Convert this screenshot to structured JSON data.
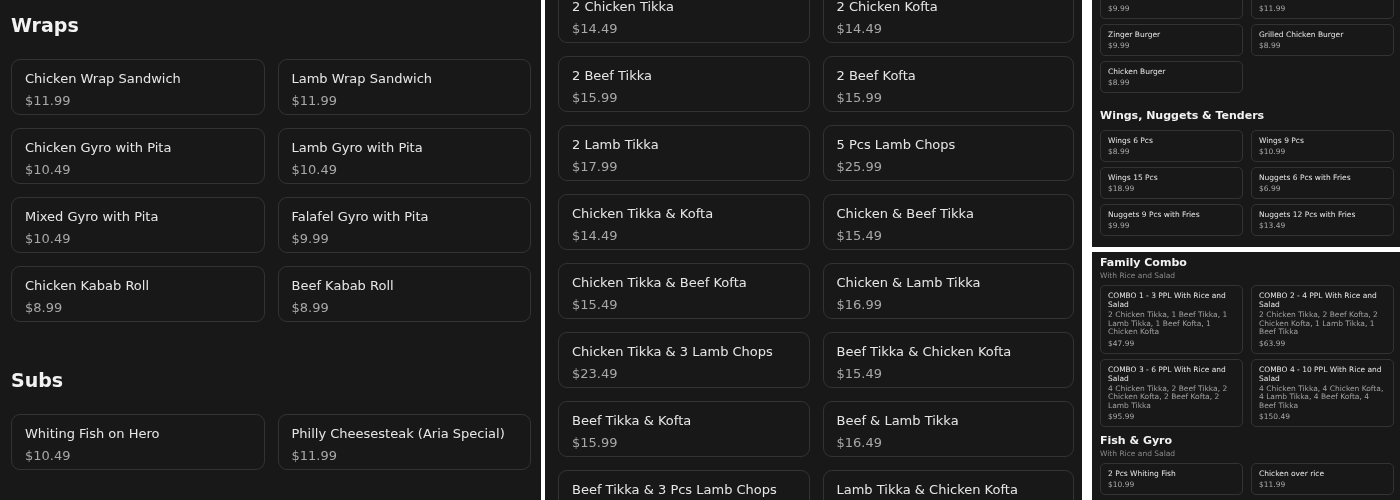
{
  "panels": [
    {
      "sections": [
        {
          "title": "Wraps",
          "items": [
            {
              "name": "Chicken Wrap Sandwich",
              "price": "$11.99"
            },
            {
              "name": "Lamb Wrap Sandwich",
              "price": "$11.99"
            },
            {
              "name": "Chicken Gyro with Pita",
              "price": "$10.49"
            },
            {
              "name": "Lamb Gyro with Pita",
              "price": "$10.49"
            },
            {
              "name": "Mixed Gyro with Pita",
              "price": "$10.49"
            },
            {
              "name": "Falafel Gyro with Pita",
              "price": "$9.99"
            },
            {
              "name": "Chicken Kabab Roll",
              "price": "$8.99"
            },
            {
              "name": "Beef Kabab Roll",
              "price": "$8.99"
            }
          ]
        },
        {
          "title": "Subs",
          "items": [
            {
              "name": "Whiting Fish on Hero",
              "price": "$10.49"
            },
            {
              "name": "Philly Cheesesteak (Aria Special)",
              "price": "$11.99"
            }
          ]
        }
      ]
    },
    {
      "sections": [
        {
          "items": [
            {
              "name": "2 Chicken Tikka",
              "price": "$14.49"
            },
            {
              "name": "2 Chicken Kofta",
              "price": "$14.49"
            },
            {
              "name": "2 Beef Tikka",
              "price": "$15.99"
            },
            {
              "name": "2 Beef Kofta",
              "price": "$15.99"
            },
            {
              "name": "2 Lamb Tikka",
              "price": "$17.99"
            },
            {
              "name": "5 Pcs Lamb Chops",
              "price": "$25.99"
            },
            {
              "name": "Chicken Tikka & Kofta",
              "price": "$14.49"
            },
            {
              "name": "Chicken & Beef Tikka",
              "price": "$15.49"
            },
            {
              "name": "Chicken Tikka & Beef Kofta",
              "price": "$15.49"
            },
            {
              "name": "Chicken & Lamb Tikka",
              "price": "$16.99"
            },
            {
              "name": "Chicken Tikka & 3 Lamb Chops",
              "price": "$23.49"
            },
            {
              "name": "Beef Tikka & Chicken Kofta",
              "price": "$15.49"
            },
            {
              "name": "Beef Tikka & Kofta",
              "price": "$15.99"
            },
            {
              "name": "Beef & Lamb Tikka",
              "price": "$16.49"
            },
            {
              "name": "Beef Tikka & 3 Pcs Lamb Chops"
            },
            {
              "name": "Lamb Tikka & Chicken Kofta"
            }
          ]
        }
      ]
    },
    {
      "sections": [
        {
          "items": [
            {
              "price": "$9.99"
            },
            {
              "price": "$11.99"
            },
            {
              "name": "Zinger Burger",
              "price": "$9.99"
            },
            {
              "name": "Grilled Chicken Burger",
              "price": "$8.99"
            },
            {
              "name": "Chicken Burger",
              "price": "$8.99"
            }
          ]
        },
        {
          "title": "Wings, Nuggets & Tenders",
          "items": [
            {
              "name": "Wings 6 Pcs",
              "price": "$8.99"
            },
            {
              "name": "Wings 9 Pcs",
              "price": "$10.99"
            },
            {
              "name": "Wings 15 Pcs",
              "price": "$18.99"
            },
            {
              "name": "Nuggets 6 Pcs with Fries",
              "price": "$6.99"
            },
            {
              "name": "Nuggets 9 Pcs with Fries",
              "price": "$9.99"
            },
            {
              "name": "Nuggets 12 Pcs with Fries",
              "price": "$13.49"
            }
          ]
        }
      ]
    },
    {
      "sections": [
        {
          "title": "Family Combo",
          "subtitle": "With Rice and Salad",
          "items": [
            {
              "name": "COMBO 1 - 3 PPL With Rice and Salad",
              "description": "2 Chicken Tikka, 1 Beef Tikka, 1 Lamb Tikka, 1 Beef Kofta, 1 Chicken Kofta",
              "price": "$47.99"
            },
            {
              "name": "COMBO 2 - 4 PPL With Rice and Salad",
              "description": "2 Chicken Tikka, 2 Beef Kofta, 2 Chicken Kofta, 1 Lamb Tikka, 1 Beef Tikka",
              "price": "$63.99"
            },
            {
              "name": "COMBO 3 - 6 PPL With Rice and Salad",
              "description": "4 Chicken Tikka, 2 Beef Tikka, 2 Chicken Kofta, 2 Beef Kofta, 2 Lamb Tikka",
              "price": "$95.99"
            },
            {
              "name": "COMBO 4 - 10 PPL With Rice and Salad",
              "description": "4 Chicken Tikka, 4 Chicken Kofta, 4 Lamb Tikka, 4 Beef Kofta, 4 Beef Tikka",
              "price": "$150.49"
            }
          ]
        },
        {
          "title": "Fish & Gyro",
          "subtitle": "With Rice and Salad",
          "items": [
            {
              "name": "2 Pcs Whiting Fish",
              "price": "$10.99"
            },
            {
              "name": "Chicken over rice",
              "price": "$11.99"
            }
          ]
        }
      ]
    }
  ]
}
